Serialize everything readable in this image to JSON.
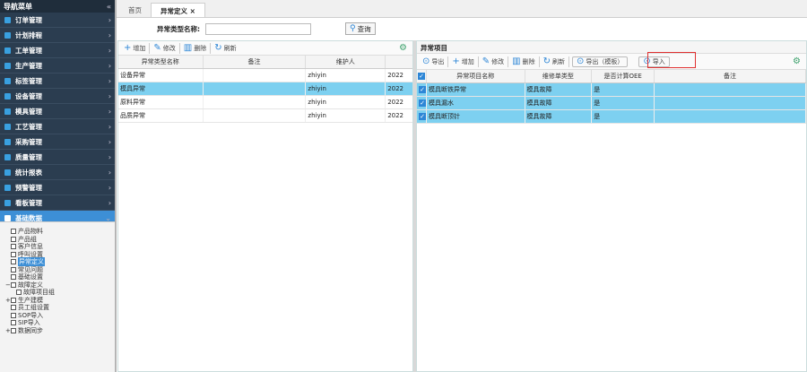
{
  "sidebar": {
    "title": "导航菜单",
    "collapse_glyph": "«",
    "items": [
      {
        "label": "订单管理",
        "icon": "order-icon",
        "color": "#39a0e0"
      },
      {
        "label": "计划排程",
        "icon": "calendar-icon",
        "color": "#39a0e0"
      },
      {
        "label": "工单管理",
        "icon": "workorder-icon",
        "color": "#39a0e0"
      },
      {
        "label": "生产管理",
        "icon": "gear-icon",
        "color": "#39a0e0"
      },
      {
        "label": "标签管理",
        "icon": "tag-icon",
        "color": "#39a0e0"
      },
      {
        "label": "设备管理",
        "icon": "equipment-icon",
        "color": "#39a0e0"
      },
      {
        "label": "模具管理",
        "icon": "mold-icon",
        "color": "#39a0e0"
      },
      {
        "label": "工艺管理",
        "icon": "process-icon",
        "color": "#39a0e0"
      },
      {
        "label": "采购管理",
        "icon": "cart-icon",
        "color": "#39a0e0"
      },
      {
        "label": "质量管理",
        "icon": "quality-icon",
        "color": "#39a0e0"
      },
      {
        "label": "统计报表",
        "icon": "chart-icon",
        "color": "#39a0e0"
      },
      {
        "label": "预警管理",
        "icon": "alert-icon",
        "color": "#39a0e0"
      },
      {
        "label": "看板管理",
        "icon": "board-icon",
        "color": "#39a0e0"
      },
      {
        "label": "基础数据",
        "icon": "database-icon",
        "color": "#ffffff",
        "active": true
      }
    ],
    "tree": [
      {
        "label": "产品物料",
        "indent": 1
      },
      {
        "label": "产品组",
        "indent": 1
      },
      {
        "label": "客户信息",
        "indent": 1
      },
      {
        "label": "呼叫设置",
        "indent": 1
      },
      {
        "label": "异常定义",
        "indent": 1,
        "selected": true
      },
      {
        "label": "常见问题",
        "indent": 1
      },
      {
        "label": "基础设置",
        "indent": 1
      },
      {
        "label": "故障定义",
        "indent": 0,
        "expander": "−"
      },
      {
        "label": "故障项目组",
        "indent": 2
      },
      {
        "label": "生产建模",
        "indent": 0,
        "expander": "+"
      },
      {
        "label": "员工组设置",
        "indent": 1
      },
      {
        "label": "SOP导入",
        "indent": 1
      },
      {
        "label": "SIP导入",
        "indent": 1
      },
      {
        "label": "数据同步",
        "indent": 0,
        "expander": "+"
      }
    ]
  },
  "tabs": [
    {
      "label": "首页",
      "active": false
    },
    {
      "label": "异常定义 ×",
      "active": true
    }
  ],
  "filter": {
    "label": "异常类型名称:",
    "value": "",
    "search_label": "查询"
  },
  "left": {
    "toolbar": {
      "add": "增加",
      "edit": "修改",
      "delete": "删除",
      "refresh": "刷新"
    },
    "columns": [
      "异常类型名称",
      "备注",
      "维护人",
      ""
    ],
    "rows": [
      {
        "name": "设备异常",
        "note": "",
        "maintainer": "zhiyin",
        "date": "2022",
        "selected": false
      },
      {
        "name": "模具异常",
        "note": "",
        "maintainer": "zhiyin",
        "date": "2022",
        "selected": true
      },
      {
        "name": "原料异常",
        "note": "",
        "maintainer": "zhiyin",
        "date": "2022",
        "selected": false
      },
      {
        "name": "品质异常",
        "note": "",
        "maintainer": "zhiyin",
        "date": "2022",
        "selected": false
      }
    ]
  },
  "right": {
    "title": "异常项目",
    "toolbar": {
      "export": "导出",
      "add": "增加",
      "edit": "修改",
      "delete": "删除",
      "refresh": "刷新",
      "export_template": "导出（模板）",
      "import": "导入"
    },
    "columns": [
      "异常项目名称",
      "维修单类型",
      "是否计算OEE",
      "备注"
    ],
    "rows": [
      {
        "name": "模具断铁异常",
        "type": "模具故障",
        "oee": "是",
        "note": ""
      },
      {
        "name": "模具漏水",
        "type": "模具故障",
        "oee": "是",
        "note": ""
      },
      {
        "name": "模具断顶针",
        "type": "模具故障",
        "oee": "是",
        "note": ""
      }
    ]
  },
  "colors": {
    "accent": "#3d8fd6",
    "selected_row": "#7dd0f0",
    "highlight_box": "#e03030"
  }
}
